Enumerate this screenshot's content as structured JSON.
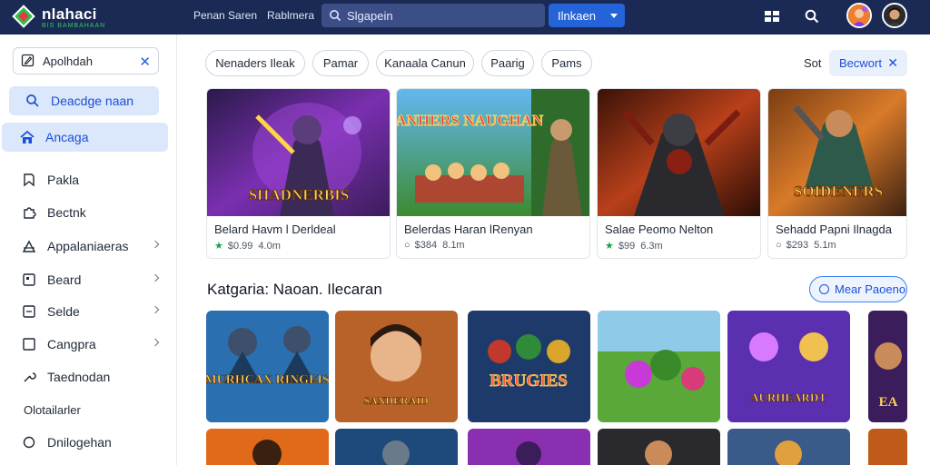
{
  "header": {
    "logo_text": "nlahaci",
    "logo_sub": "BIS BAMBAHAAN",
    "nav": [
      "Penan Saren",
      "Rablmera"
    ],
    "search_value": "Slgapein",
    "select_label": "Ilnkaen",
    "icons": [
      "grid-icon",
      "search-icon"
    ],
    "accent": "#2563d9",
    "bar_color": "#1b2a55"
  },
  "sidebar": {
    "search_value": "Apolhdah",
    "items": [
      {
        "label": "Deacdge naan",
        "icon": "search-icon"
      },
      {
        "label": "Ancaga",
        "icon": "home-icon"
      },
      {
        "label": "Pakla",
        "icon": "bookmark-icon"
      },
      {
        "label": "Bectnk",
        "icon": "puzzle-icon"
      },
      {
        "label": "Appalaniaeras",
        "icon": "tent-icon"
      },
      {
        "label": "Beard",
        "icon": "square-icon"
      },
      {
        "label": "Selde",
        "icon": "square-icon"
      },
      {
        "label": "Cangpra",
        "icon": "square-icon"
      },
      {
        "label": "Taednodan",
        "icon": "wrench-icon"
      }
    ],
    "section_label": "Olotailarler",
    "bottom_item": {
      "label": "Dnilogehan",
      "icon": "circle-icon"
    }
  },
  "filters": {
    "chips": [
      "Nenaders Ileak",
      "Pamar",
      "Kanaala Canun",
      "Paarig",
      "Pams"
    ],
    "sort_label": "Sot",
    "sort_value": "Becwort"
  },
  "featured": [
    {
      "title": "Belard Havm l Derldeal",
      "price": "$0.99",
      "rating": "4.0m",
      "art_text": "SHADNERBIS"
    },
    {
      "title": "Belerdas Haran lRenyan",
      "price": "$384",
      "rating": "8.1m",
      "art_text": "SANHERS NAUGHAN"
    },
    {
      "title": "Salae Peomo Nelton",
      "price": "$99",
      "rating": "6.3m",
      "art_text": ""
    },
    {
      "title": "Sehadd Papni Ilnagda",
      "price": "$293",
      "rating": "5.1m",
      "art_text": "SOIDENERS"
    }
  ],
  "category": {
    "title": "Katgaria: Naoan. Ilecaran",
    "more_label": "Mear Paoeno",
    "tiles": [
      {
        "art_text": "MURHCAX RINGEIS"
      },
      {
        "art_text": "SANDERAID"
      },
      {
        "art_text": "BRUGIES"
      },
      {
        "art_text": ""
      },
      {
        "art_text": "AURHEARDT"
      },
      {
        "art_text": "EA"
      }
    ]
  }
}
